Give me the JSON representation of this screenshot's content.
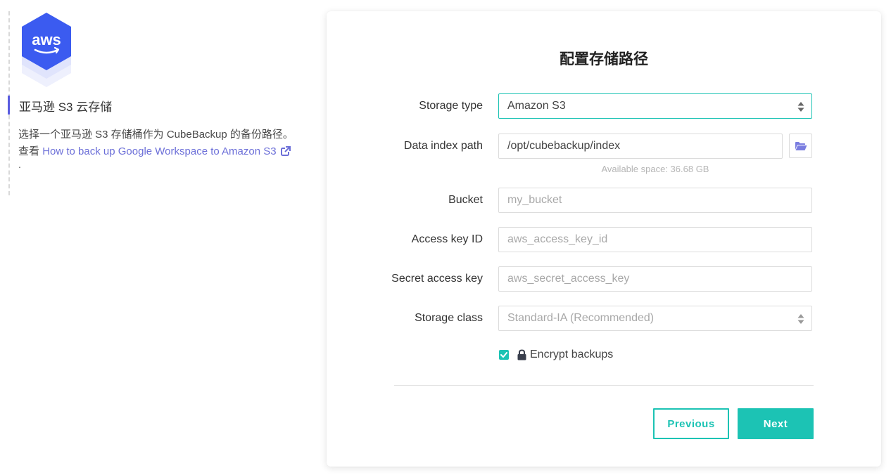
{
  "left": {
    "logo_text": "aws",
    "title": "亚马逊 S3 云存储",
    "description": "选择一个亚马逊 S3 存储桶作为 CubeBackup 的备份路径。",
    "see_prefix": "查看",
    "link_text": "How to back up Google Workspace to Amazon S3",
    "trailing": "."
  },
  "form": {
    "title": "配置存储路径",
    "storage_type": {
      "label": "Storage type",
      "value": "Amazon S3"
    },
    "data_index_path": {
      "label": "Data index path",
      "value": "/opt/cubebackup/index",
      "available_space": "Available space: 36.68 GB"
    },
    "bucket": {
      "label": "Bucket",
      "placeholder": "my_bucket"
    },
    "access_key_id": {
      "label": "Access key ID",
      "placeholder": "aws_access_key_id"
    },
    "secret_access_key": {
      "label": "Secret access key",
      "placeholder": "aws_secret_access_key"
    },
    "storage_class": {
      "label": "Storage class",
      "value": "Standard-IA (Recommended)"
    },
    "encrypt": {
      "label": "Encrypt backups",
      "checked": true
    }
  },
  "buttons": {
    "previous": "Previous",
    "next": "Next"
  },
  "colors": {
    "accent": "#1cc3b4",
    "link": "#6c6fd8",
    "aws_logo": "#3b5bf0"
  },
  "icons": {
    "logo": "aws-hexagon-icon",
    "external_link": "external-link-icon",
    "folder": "folder-open-icon",
    "lock": "lock-icon",
    "select_arrows": "sort-arrows-icon",
    "checkbox": "check-icon"
  }
}
